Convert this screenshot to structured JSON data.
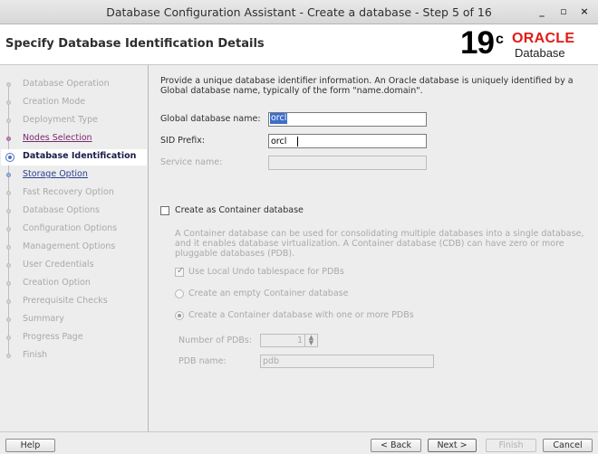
{
  "window": {
    "title": "Database Configuration Assistant - Create a database - Step 5 of 16",
    "minimize_glyph": "_",
    "maximize_glyph": "▫",
    "close_glyph": "×"
  },
  "header": {
    "page_title": "Specify Database Identification Details",
    "logo_version": "19",
    "logo_superscript": "c",
    "logo_brand": "ORACLE",
    "logo_product": "Database"
  },
  "steps": [
    {
      "label": "Database Operation",
      "state": "done"
    },
    {
      "label": "Creation Mode",
      "state": "done"
    },
    {
      "label": "Deployment Type",
      "state": "done"
    },
    {
      "label": "Nodes Selection",
      "state": "link"
    },
    {
      "label": "Database Identification",
      "state": "active"
    },
    {
      "label": "Storage Option",
      "state": "link2"
    },
    {
      "label": "Fast Recovery Option",
      "state": "pending"
    },
    {
      "label": "Database Options",
      "state": "pending"
    },
    {
      "label": "Configuration Options",
      "state": "pending"
    },
    {
      "label": "Management Options",
      "state": "pending"
    },
    {
      "label": "User Credentials",
      "state": "pending"
    },
    {
      "label": "Creation Option",
      "state": "pending"
    },
    {
      "label": "Prerequisite Checks",
      "state": "pending"
    },
    {
      "label": "Summary",
      "state": "pending"
    },
    {
      "label": "Progress Page",
      "state": "pending"
    },
    {
      "label": "Finish",
      "state": "pending"
    }
  ],
  "main": {
    "description": "Provide a unique database identifier information. An Oracle database is uniquely identified by a Global database name, typically of the form \"name.domain\".",
    "global_db_name_label": "Global database name:",
    "global_db_name_value": "orcl",
    "sid_prefix_label": "SID Prefix:",
    "sid_prefix_value": "orcl",
    "service_name_label": "Service name:",
    "service_name_value": "",
    "container_checkbox_label": "Create as Container database",
    "container_checked": false,
    "container_description": "A Container database can be used for consolidating multiple databases into a single database, and it enables database virtualization. A Container database (CDB) can have zero or more pluggable databases (PDB).",
    "local_undo_label": "Use Local Undo tablespace for PDBs",
    "local_undo_checked": true,
    "empty_container_label": "Create an empty Container database",
    "with_pdbs_label": "Create a Container database with one or more PDBs",
    "num_pdbs_label": "Number of PDBs:",
    "num_pdbs_value": "1",
    "pdb_name_label": "PDB name:",
    "pdb_name_value": "pdb"
  },
  "footer": {
    "help_label": "Help",
    "back_label": "< Back",
    "next_label": "Next >",
    "finish_label": "Finish",
    "cancel_label": "Cancel"
  }
}
